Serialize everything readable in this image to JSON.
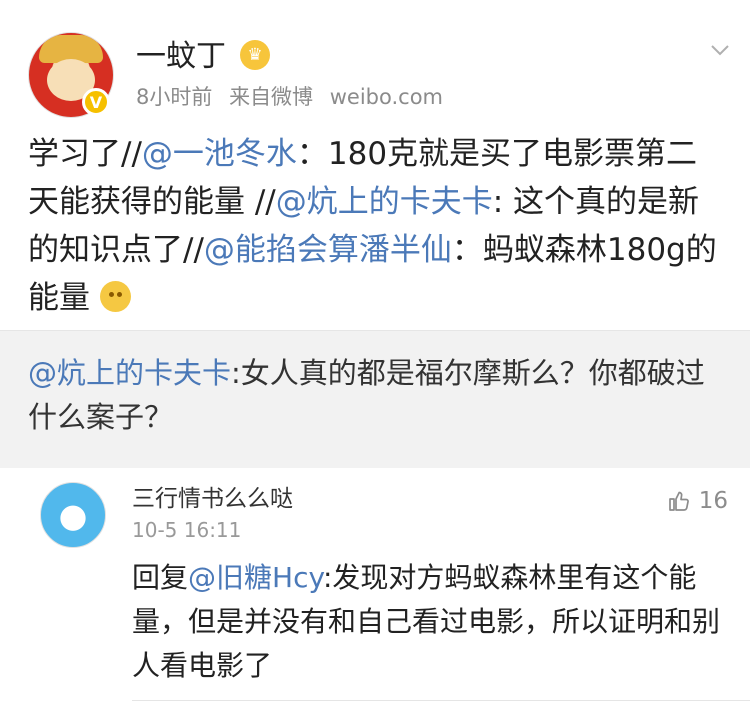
{
  "post": {
    "author": "一蚊丁",
    "meta": {
      "time": "8小时前",
      "source_prefix": "来自微博",
      "source": "weibo.com"
    },
    "content": {
      "prefix": "学习了//",
      "mention1": "@一池冬水",
      "text1": "：180克就是买了电影票第二天能获得的能量 //",
      "mention2": "@炕上的卡夫卡",
      "text2": ": 这个真的是新的知识点了//",
      "mention3": "@能掐会算潘半仙",
      "text3": "：蚂蚁森林180g的能量"
    },
    "verified_badge": "V"
  },
  "quote": {
    "mention": "@炕上的卡夫卡",
    "text": ":女人真的都是福尔摩斯么？你都破过什么案子？"
  },
  "comment": {
    "name": "三行情书么么哒",
    "time": "10-5 16:11",
    "likes": "16",
    "reply_prefix": "回复",
    "mention": "@旧糖Hcy",
    "text": ":发现对方蚂蚁森林里有这个能量，但是并没有和自己看过电影，所以证明和别人看电影了"
  },
  "icons": {
    "crown": "crown-icon",
    "chevron": "chevron-down-icon",
    "emoji": "emoji-icon",
    "thumb": "thumb-up-icon"
  },
  "colors": {
    "mention": "#4b79b8",
    "quote_background": "#f2f2f2",
    "secondary_text": "#8b8b8b"
  }
}
